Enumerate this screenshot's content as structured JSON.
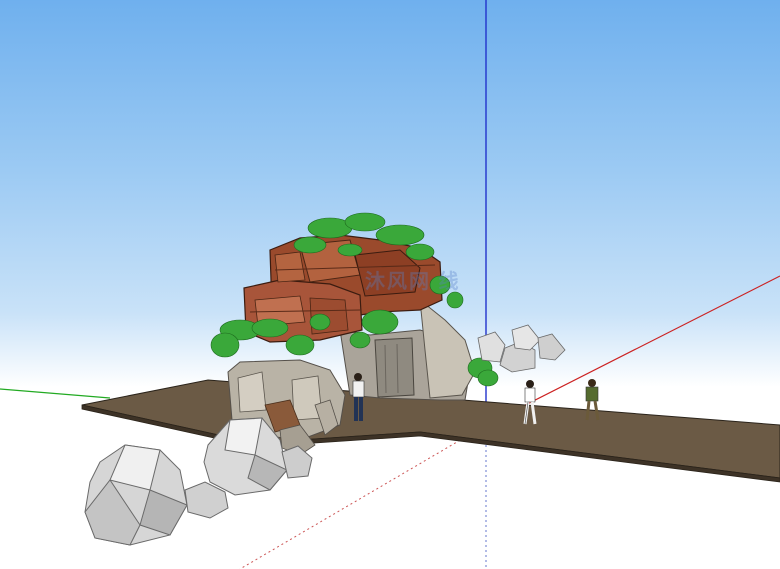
{
  "viewport": {
    "label": ""
  },
  "watermark": {
    "text": "沐风网 线"
  },
  "colors": {
    "sky_top": "#6fb0ee",
    "ground": "#ffffff",
    "axis_red": "#cc2222",
    "axis_green": "#22aa22",
    "axis_blue": "#2233cc",
    "platform": "#6b5a45",
    "rock_red": "#9a4a2c",
    "rock_gray": "#b9b3a6",
    "foliage": "#3aa83a",
    "boulder": "#c8c8c8"
  },
  "icons": [
    "person-walking-icon",
    "person-standing-icon"
  ]
}
